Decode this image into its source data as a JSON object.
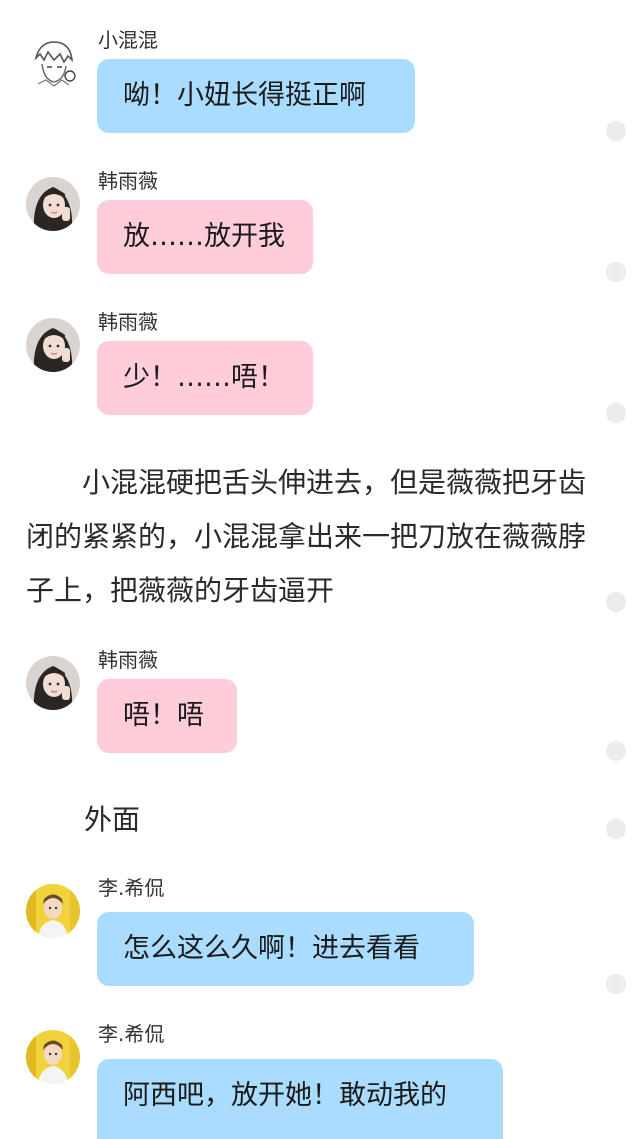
{
  "messages": [
    {
      "speaker": "小混混",
      "text": "呦！小妞长得挺正啊",
      "color": "#a9dcff",
      "avatar": "sketch-boy-avatar"
    },
    {
      "speaker": "韩雨薇",
      "text": "放……放开我",
      "color": "#ffccd9",
      "avatar": "girl-avatar"
    },
    {
      "speaker": "韩雨薇",
      "text": "少！……唔！",
      "color": "#ffccd9",
      "avatar": "girl-avatar"
    },
    {
      "speaker": "韩雨薇",
      "text": "唔！唔",
      "color": "#ffccd9",
      "avatar": "girl-avatar"
    },
    {
      "speaker": "李.希侃",
      "text": "怎么这么久啊！进去看看",
      "color": "#a9dcff",
      "avatar": "yellow-boy-avatar"
    },
    {
      "speaker": "李.希侃",
      "text": "阿西吧，放开她！敢动我的",
      "color": "#a9dcff",
      "avatar": "yellow-boy-avatar"
    }
  ],
  "narration": "小混混硬把舌头伸进去，但是薇薇把牙齿闭的紧紧的，小混混拿出来一把刀放在薇薇脖子上，把薇薇的牙齿逼开",
  "scene": "外面",
  "colors": {
    "blue_bubble": "#a9dcff",
    "pink_bubble": "#ffccd9",
    "dot": "#ececec"
  }
}
